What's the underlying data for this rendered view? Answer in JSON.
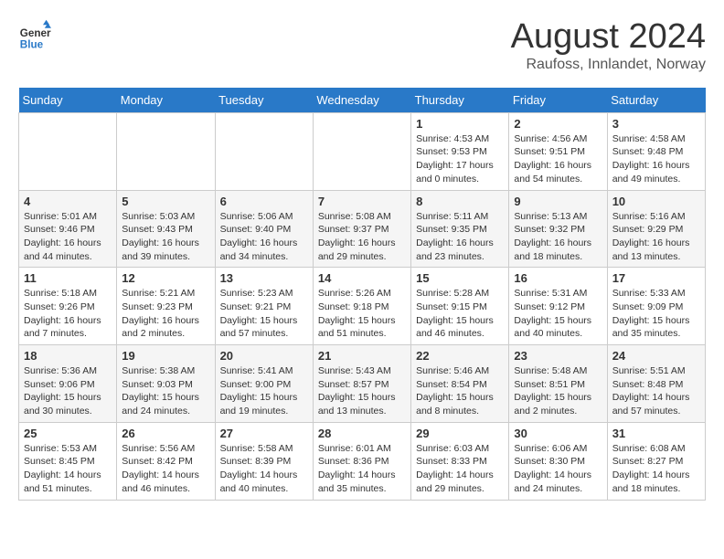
{
  "logo": {
    "line1": "General",
    "line2": "Blue"
  },
  "title": "August 2024",
  "subtitle": "Raufoss, Innlandet, Norway",
  "weekdays": [
    "Sunday",
    "Monday",
    "Tuesday",
    "Wednesday",
    "Thursday",
    "Friday",
    "Saturday"
  ],
  "weeks": [
    [
      {
        "day": "",
        "info": ""
      },
      {
        "day": "",
        "info": ""
      },
      {
        "day": "",
        "info": ""
      },
      {
        "day": "",
        "info": ""
      },
      {
        "day": "1",
        "info": "Sunrise: 4:53 AM\nSunset: 9:53 PM\nDaylight: 17 hours\nand 0 minutes."
      },
      {
        "day": "2",
        "info": "Sunrise: 4:56 AM\nSunset: 9:51 PM\nDaylight: 16 hours\nand 54 minutes."
      },
      {
        "day": "3",
        "info": "Sunrise: 4:58 AM\nSunset: 9:48 PM\nDaylight: 16 hours\nand 49 minutes."
      }
    ],
    [
      {
        "day": "4",
        "info": "Sunrise: 5:01 AM\nSunset: 9:46 PM\nDaylight: 16 hours\nand 44 minutes."
      },
      {
        "day": "5",
        "info": "Sunrise: 5:03 AM\nSunset: 9:43 PM\nDaylight: 16 hours\nand 39 minutes."
      },
      {
        "day": "6",
        "info": "Sunrise: 5:06 AM\nSunset: 9:40 PM\nDaylight: 16 hours\nand 34 minutes."
      },
      {
        "day": "7",
        "info": "Sunrise: 5:08 AM\nSunset: 9:37 PM\nDaylight: 16 hours\nand 29 minutes."
      },
      {
        "day": "8",
        "info": "Sunrise: 5:11 AM\nSunset: 9:35 PM\nDaylight: 16 hours\nand 23 minutes."
      },
      {
        "day": "9",
        "info": "Sunrise: 5:13 AM\nSunset: 9:32 PM\nDaylight: 16 hours\nand 18 minutes."
      },
      {
        "day": "10",
        "info": "Sunrise: 5:16 AM\nSunset: 9:29 PM\nDaylight: 16 hours\nand 13 minutes."
      }
    ],
    [
      {
        "day": "11",
        "info": "Sunrise: 5:18 AM\nSunset: 9:26 PM\nDaylight: 16 hours\nand 7 minutes."
      },
      {
        "day": "12",
        "info": "Sunrise: 5:21 AM\nSunset: 9:23 PM\nDaylight: 16 hours\nand 2 minutes."
      },
      {
        "day": "13",
        "info": "Sunrise: 5:23 AM\nSunset: 9:21 PM\nDaylight: 15 hours\nand 57 minutes."
      },
      {
        "day": "14",
        "info": "Sunrise: 5:26 AM\nSunset: 9:18 PM\nDaylight: 15 hours\nand 51 minutes."
      },
      {
        "day": "15",
        "info": "Sunrise: 5:28 AM\nSunset: 9:15 PM\nDaylight: 15 hours\nand 46 minutes."
      },
      {
        "day": "16",
        "info": "Sunrise: 5:31 AM\nSunset: 9:12 PM\nDaylight: 15 hours\nand 40 minutes."
      },
      {
        "day": "17",
        "info": "Sunrise: 5:33 AM\nSunset: 9:09 PM\nDaylight: 15 hours\nand 35 minutes."
      }
    ],
    [
      {
        "day": "18",
        "info": "Sunrise: 5:36 AM\nSunset: 9:06 PM\nDaylight: 15 hours\nand 30 minutes."
      },
      {
        "day": "19",
        "info": "Sunrise: 5:38 AM\nSunset: 9:03 PM\nDaylight: 15 hours\nand 24 minutes."
      },
      {
        "day": "20",
        "info": "Sunrise: 5:41 AM\nSunset: 9:00 PM\nDaylight: 15 hours\nand 19 minutes."
      },
      {
        "day": "21",
        "info": "Sunrise: 5:43 AM\nSunset: 8:57 PM\nDaylight: 15 hours\nand 13 minutes."
      },
      {
        "day": "22",
        "info": "Sunrise: 5:46 AM\nSunset: 8:54 PM\nDaylight: 15 hours\nand 8 minutes."
      },
      {
        "day": "23",
        "info": "Sunrise: 5:48 AM\nSunset: 8:51 PM\nDaylight: 15 hours\nand 2 minutes."
      },
      {
        "day": "24",
        "info": "Sunrise: 5:51 AM\nSunset: 8:48 PM\nDaylight: 14 hours\nand 57 minutes."
      }
    ],
    [
      {
        "day": "25",
        "info": "Sunrise: 5:53 AM\nSunset: 8:45 PM\nDaylight: 14 hours\nand 51 minutes."
      },
      {
        "day": "26",
        "info": "Sunrise: 5:56 AM\nSunset: 8:42 PM\nDaylight: 14 hours\nand 46 minutes."
      },
      {
        "day": "27",
        "info": "Sunrise: 5:58 AM\nSunset: 8:39 PM\nDaylight: 14 hours\nand 40 minutes."
      },
      {
        "day": "28",
        "info": "Sunrise: 6:01 AM\nSunset: 8:36 PM\nDaylight: 14 hours\nand 35 minutes."
      },
      {
        "day": "29",
        "info": "Sunrise: 6:03 AM\nSunset: 8:33 PM\nDaylight: 14 hours\nand 29 minutes."
      },
      {
        "day": "30",
        "info": "Sunrise: 6:06 AM\nSunset: 8:30 PM\nDaylight: 14 hours\nand 24 minutes."
      },
      {
        "day": "31",
        "info": "Sunrise: 6:08 AM\nSunset: 8:27 PM\nDaylight: 14 hours\nand 18 minutes."
      }
    ]
  ]
}
